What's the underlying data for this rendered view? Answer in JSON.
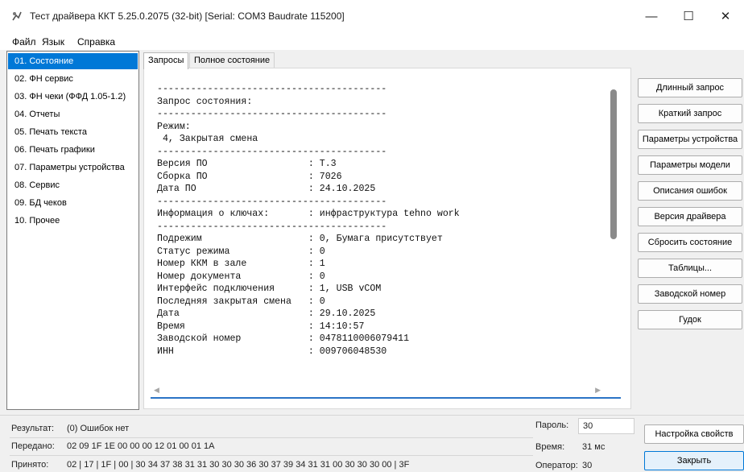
{
  "window": {
    "title": "Тест драйвера ККТ 5.25.0.2075 (32-bit) [Serial: COM3 Baudrate 115200]",
    "minimize": "—",
    "maximize": "☐",
    "close": "✕"
  },
  "menu": [
    "Файл",
    "Язык",
    "Справка"
  ],
  "nav": [
    "01. Состояние",
    "02. ФН сервис",
    "03. ФН чеки (ФФД 1.05-1.2)",
    "04. Отчеты",
    "05. Печать текста",
    "06. Печать графики",
    "07. Параметры устройства",
    "08. Сервис",
    "09. БД чеков",
    "10. Прочее"
  ],
  "tabs": [
    "Запросы",
    "Полное состояние"
  ],
  "output_lines": [
    "-----------------------------------------",
    "Запрос состояния:",
    "-----------------------------------------",
    "Режим:",
    " 4, Закрытая смена",
    "-----------------------------------------",
    "Версия ПО                  : Т.3",
    "Сборка ПО                  : 7026",
    "Дата ПО                    : 24.10.2025",
    "-----------------------------------------",
    "Информация о ключах:       : инфраструктура tehno work",
    "-----------------------------------------",
    "Подрежим                   : 0, Бумага присутствует",
    "Статус режима              : 0",
    "Номер ККМ в зале           : 1",
    "Номер документа            : 0",
    "Интерфейс подключения      : 1, USB vCOM",
    "Последняя закрытая смена   : 0",
    "Дата                       : 29.10.2025",
    "Время                      : 14:10:57",
    "Заводской номер            : 0478110006079411",
    "ИНН                        : 009706048530"
  ],
  "buttons": [
    "Длинный запрос",
    "Краткий запрос",
    "Параметры устройства",
    "Параметры модели",
    "Описания ошибок",
    "Версия драйвера",
    "Сбросить состояние",
    "Таблицы...",
    "Заводской номер",
    "Гудок"
  ],
  "status": {
    "result_label": "Результат:",
    "result_value": "(0) Ошибок нет",
    "sent_label": "Передано:",
    "sent_value": "02 09 1F 1E 00 00 00 12 01 00 01 1A",
    "received_label": "Принято:",
    "received_value": "02 | 17 | 1F | 00 | 30 34 37 38 31 31 30 30 30 36 30 37 39 34 31 31 00 30 30 30 00 | 3F",
    "password_label": "Пароль:",
    "password_value": "30",
    "time_label": "Время:",
    "time_value": "31 мс",
    "operator_label": "Оператор:",
    "operator_value": "30"
  },
  "bottom_buttons": {
    "props": "Настройка свойств",
    "close": "Закрыть"
  },
  "colors": {
    "accent": "#0078d7",
    "selection": "#0078d7"
  }
}
